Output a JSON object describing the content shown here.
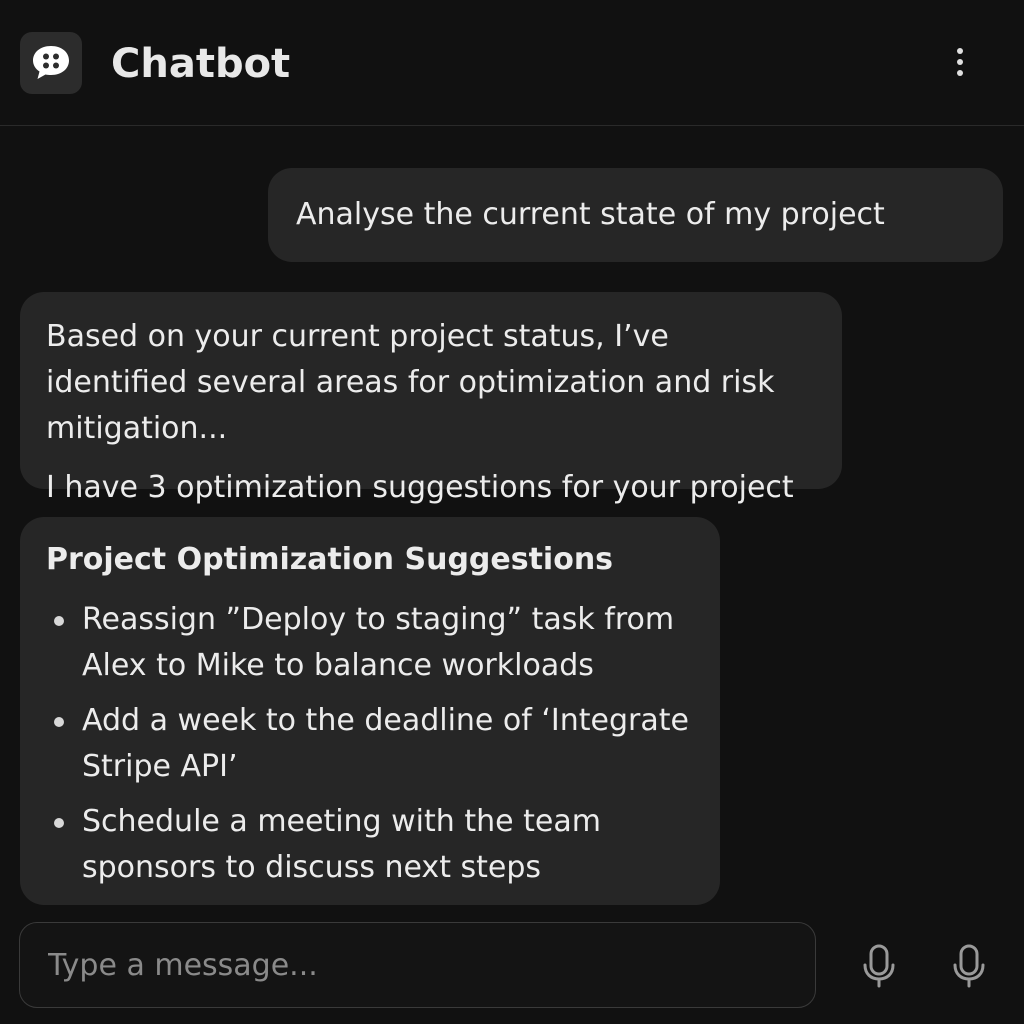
{
  "header": {
    "title": "Chatbot",
    "app_icon": "chat-bubble-icon",
    "menu_icon": "more-vertical-icon"
  },
  "messages": {
    "user": {
      "text": "Analyse the current state of my project"
    },
    "bot": {
      "paragraph1": "Based on your current project status, I’ve identified several areas for optimization and risk mitigation...",
      "paragraph2": "I have 3 optimization suggestions for your project"
    },
    "card": {
      "title": "Project Optimization Suggestions",
      "items": [
        "Reassign ”Deploy to staging” task from Alex to Mike to balance workloads",
        "Add a week to the deadline of ‘Integrate Stripe API’",
        "Schedule a meeting with the team sponsors to discuss next steps"
      ]
    }
  },
  "input": {
    "placeholder": "Type a message...",
    "value": ""
  },
  "actions": {
    "mic_icon_1": "microphone-icon",
    "mic_icon_2": "microphone-icon"
  },
  "colors": {
    "background": "#111111",
    "bubble": "#262626",
    "text": "#ececec",
    "placeholder": "#8a8a8a"
  }
}
